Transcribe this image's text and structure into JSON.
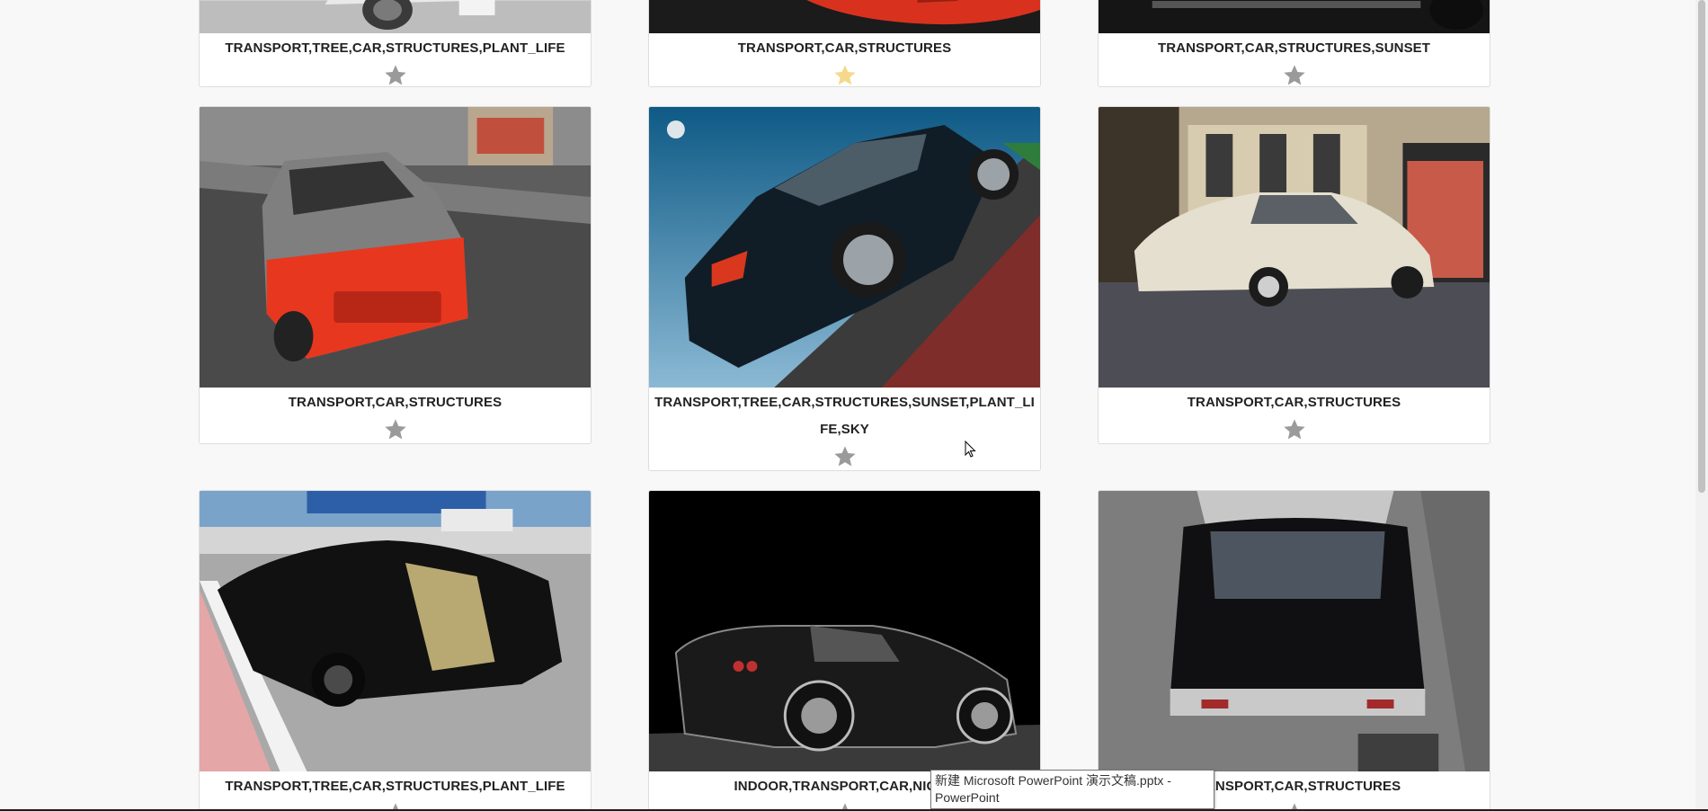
{
  "gallery": {
    "cards": [
      {
        "caption": "TRANSPORT,TREE,CAR,STRUCTURES,PLANT_LIFE",
        "starred": false
      },
      {
        "caption": "TRANSPORT,CAR,STRUCTURES",
        "starred": true
      },
      {
        "caption": "TRANSPORT,CAR,STRUCTURES,SUNSET",
        "starred": false
      },
      {
        "caption": "TRANSPORT,CAR,STRUCTURES",
        "starred": false
      },
      {
        "caption": "TRANSPORT,TREE,CAR,STRUCTURES,SUNSET,PLANT_LIFE,SKY",
        "starred": false
      },
      {
        "caption": "TRANSPORT,CAR,STRUCTURES",
        "starred": false
      },
      {
        "caption": "TRANSPORT,TREE,CAR,STRUCTURES,PLANT_LIFE",
        "starred": false
      },
      {
        "caption": "INDOOR,TRANSPORT,CAR,NIGHT",
        "starred": false
      },
      {
        "caption": "TRANSPORT,CAR,STRUCTURES",
        "starred": false
      }
    ]
  },
  "colors": {
    "star_default": "#9a9a9a",
    "star_active": "#f5d98b",
    "background": "#f8f8f8"
  },
  "tooltip": {
    "line1": "新建 Microsoft PowerPoint 演示文稿.pptx -",
    "line2": "PowerPoint"
  }
}
